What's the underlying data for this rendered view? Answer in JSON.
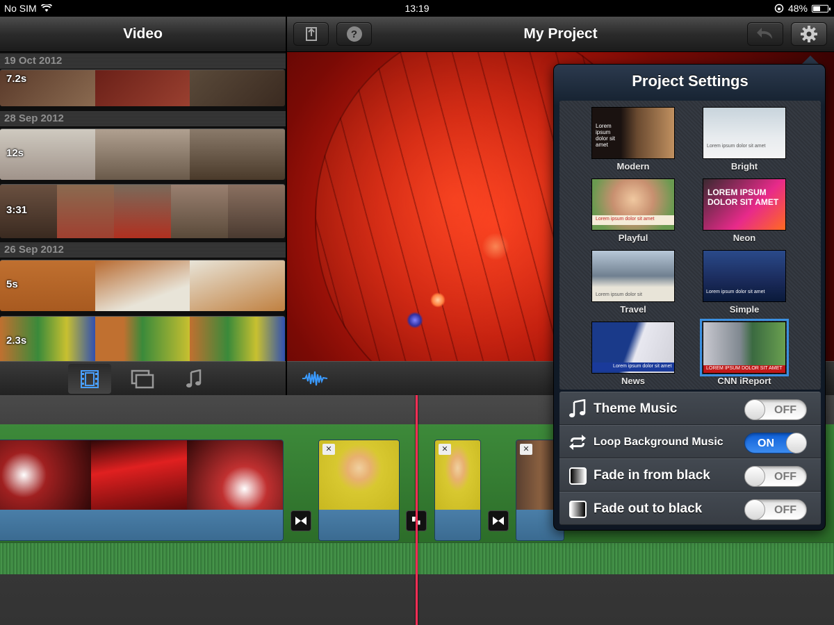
{
  "status_bar": {
    "carrier": "No SIM",
    "time": "13:19",
    "battery": "48%",
    "battery_level": 0.48
  },
  "library": {
    "title": "Video",
    "groups": [
      {
        "date": "19 Oct 2012",
        "clips": [
          {
            "duration": "7.2s"
          }
        ]
      },
      {
        "date": "28 Sep 2012",
        "clips": [
          {
            "duration": "12s"
          },
          {
            "duration": "3:31"
          }
        ]
      },
      {
        "date": "26 Sep 2012",
        "clips": [
          {
            "duration": "5s"
          },
          {
            "duration": "2.3s"
          }
        ]
      }
    ],
    "tools": [
      {
        "icon": "film-icon",
        "active": true
      },
      {
        "icon": "photos-icon",
        "active": false
      },
      {
        "icon": "music-note-icon",
        "active": false
      }
    ]
  },
  "project": {
    "title": "My Project",
    "share_icon": "share-icon",
    "help_label": "?",
    "undo_icon": "undo-icon",
    "settings_icon": "gear-icon",
    "audio_icon": "waveform-icon"
  },
  "settings": {
    "title": "Project Settings",
    "themes": [
      {
        "name": "Modern",
        "selected": false,
        "caption": "Lorem ipsum dolor sit amet"
      },
      {
        "name": "Bright",
        "selected": false,
        "caption": "Lorem ipsum dolor sit amet"
      },
      {
        "name": "Playful",
        "selected": false,
        "caption": "Lorem ipsum dolor sit amet"
      },
      {
        "name": "Neon",
        "selected": false,
        "caption": "LOREM IPSUM DOLOR SIT AMET"
      },
      {
        "name": "Travel",
        "selected": false,
        "caption": "Lorem ipsum dolor sit"
      },
      {
        "name": "Simple",
        "selected": false,
        "caption": "Lorem ipsum dolor sit amet"
      },
      {
        "name": "News",
        "selected": false,
        "caption": "Lorem ipsum dolor sit amet"
      },
      {
        "name": "CNN iReport",
        "selected": true,
        "caption": "LOREM IPSUM DOLOR SIT AMET"
      }
    ],
    "options": [
      {
        "label": "Theme Music",
        "state": "OFF",
        "icon": "music-note-icon"
      },
      {
        "label": "Loop Background Music",
        "state": "ON",
        "icon": "loop-icon"
      },
      {
        "label": "Fade in from black",
        "state": "OFF",
        "icon": "fade-in-icon"
      },
      {
        "label": "Fade out to black",
        "state": "OFF",
        "icon": "fade-out-icon"
      }
    ]
  },
  "colors": {
    "accent": "#3b8fe0",
    "playhead": "#ff2d55",
    "track_green": "#3d8a3a",
    "toggle_on": "#1a6fe0"
  }
}
